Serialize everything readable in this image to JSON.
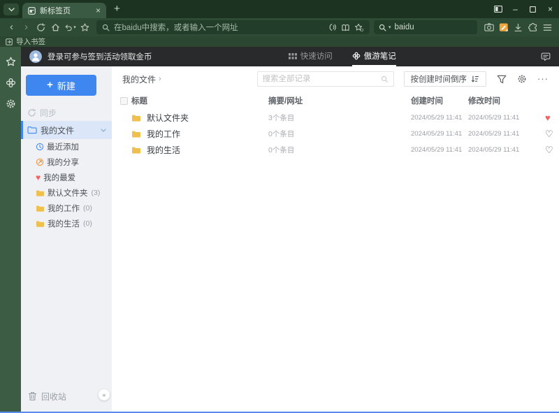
{
  "browser": {
    "tab_title": "新标签页",
    "address_placeholder": "在baidu中搜索，或者输入一个网址",
    "search_engine": "baidu",
    "import_bookmarks": "导入书签"
  },
  "icons": {
    "plus": "+",
    "close": "×",
    "minimize": "–",
    "back": "‹",
    "forward": "›",
    "caret_down": "▾",
    "collapse": "«",
    "more": "···",
    "breadcrumb_arrow": "›",
    "heart_filled": "♥",
    "heart_outline": "♡"
  },
  "notes": {
    "header": {
      "login_text": "登录可参与签到活动领取金币",
      "tab_quick_access": "快速访问",
      "tab_notes": "傲游笔记"
    },
    "sidebar": {
      "new_label": "新建",
      "sync_label": "同步",
      "my_files_label": "我的文件",
      "items": [
        {
          "label": "最近添加",
          "count": "",
          "icon": "clock-icon"
        },
        {
          "label": "我的分享",
          "count": "",
          "icon": "share-icon"
        },
        {
          "label": "我的最爱",
          "count": "",
          "icon": "heart-icon"
        },
        {
          "label": "默认文件夹",
          "count": "(3)",
          "icon": "folder-icon"
        },
        {
          "label": "我的工作",
          "count": "(0)",
          "icon": "folder-icon"
        },
        {
          "label": "我的生活",
          "count": "(0)",
          "icon": "folder-icon"
        }
      ],
      "recycle_label": "回收站"
    },
    "main": {
      "breadcrumb": "我的文件",
      "search_placeholder": "搜索全部记录",
      "sort_label": "按创建时间倒序",
      "columns": {
        "title": "标题",
        "summary": "摘要/网址",
        "created": "创建时间",
        "modified": "修改时间"
      },
      "rows": [
        {
          "title": "默认文件夹",
          "summary": "3个条目",
          "created": "2024/05/29 11:41",
          "modified": "2024/05/29 11:41",
          "favorite": true
        },
        {
          "title": "我的工作",
          "summary": "0个条目",
          "created": "2024/05/29 11:41",
          "modified": "2024/05/29 11:41",
          "favorite": false
        },
        {
          "title": "我的生活",
          "summary": "0个条目",
          "created": "2024/05/29 11:41",
          "modified": "2024/05/29 11:41",
          "favorite": false
        }
      ]
    }
  },
  "colors": {
    "titlebar": "#1c3322",
    "toolbar": "#2e4b36",
    "tab_active": "#3a5a43",
    "field": "#223d2a",
    "left_strip": "#3c5c44",
    "page_header": "#292a2b",
    "accent_blue": "#3f87f0",
    "selected_bg": "#dbe7f8",
    "folder_yellow": "#f0c04e",
    "heart_red": "#f5615f",
    "note_orange": "#f2a73d",
    "bottom_edge": "#5b8cf0"
  }
}
